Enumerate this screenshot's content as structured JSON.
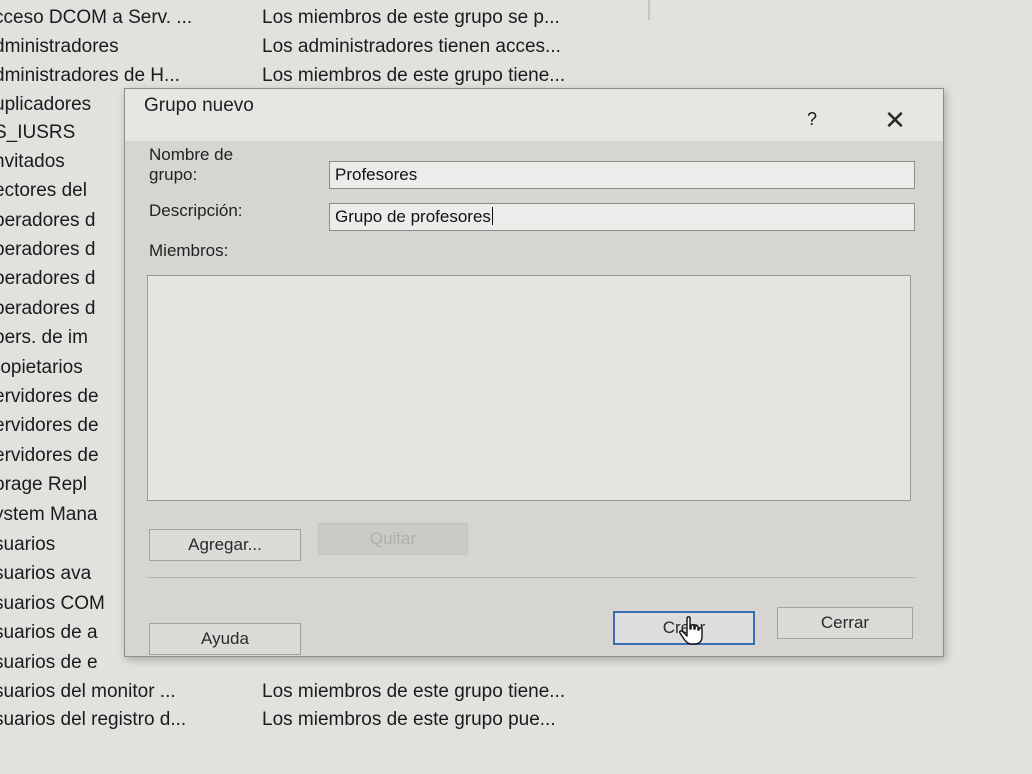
{
  "background_list": {
    "rows": [
      {
        "name": "cceso DCOM a Serv. ...",
        "description": "Los miembros de este grupo se p..."
      },
      {
        "name": "dministradores",
        "description": "Los administradores tienen acces..."
      },
      {
        "name": "dministradores de H...",
        "description": "Los miembros de este grupo tiene..."
      },
      {
        "name": "uplicadores",
        "description": ""
      },
      {
        "name": "S_IUSRS",
        "description": ""
      },
      {
        "name": "nvitados",
        "description": ""
      },
      {
        "name": "ectores del",
        "description": ""
      },
      {
        "name": "peradores d",
        "description": ""
      },
      {
        "name": "peradores d",
        "description": ""
      },
      {
        "name": "peradores d",
        "description": ""
      },
      {
        "name": "peradores d",
        "description": ""
      },
      {
        "name": "pers. de im",
        "description": ""
      },
      {
        "name": "ropietarios",
        "description": ""
      },
      {
        "name": "ervidores de",
        "description": ""
      },
      {
        "name": "ervidores de",
        "description": ""
      },
      {
        "name": "ervidores de",
        "description": ""
      },
      {
        "name": "orage Repl",
        "description": ""
      },
      {
        "name": "ystem Mana",
        "description": ""
      },
      {
        "name": "suarios",
        "description": ""
      },
      {
        "name": "suarios ava",
        "description": ""
      },
      {
        "name": "suarios COM",
        "description": ""
      },
      {
        "name": "suarios de a",
        "description": ""
      },
      {
        "name": "suarios de e",
        "description": ""
      },
      {
        "name": "suarios del monitor ...",
        "description": "Los miembros de este grupo tiene..."
      },
      {
        "name": "suarios del registro d...",
        "description": "Los miembros de este grupo pue..."
      }
    ]
  },
  "dialog": {
    "title": "Grupo nuevo",
    "help_label": "?",
    "close_label": "✕",
    "group_name_label_line1": "Nombre de",
    "group_name_label_line2": "grupo:",
    "group_name_value": "Profesores",
    "description_label": "Descripción:",
    "description_value": "Grupo de profesores",
    "members_label": "Miembros:",
    "add_button": "Agregar...",
    "remove_button": "Quitar",
    "help_button": "Ayuda",
    "create_button": "Crear",
    "close_button": "Cerrar"
  },
  "icons": {
    "cursor": "hand-pointer-icon",
    "close": "close-icon",
    "help": "help-icon"
  }
}
